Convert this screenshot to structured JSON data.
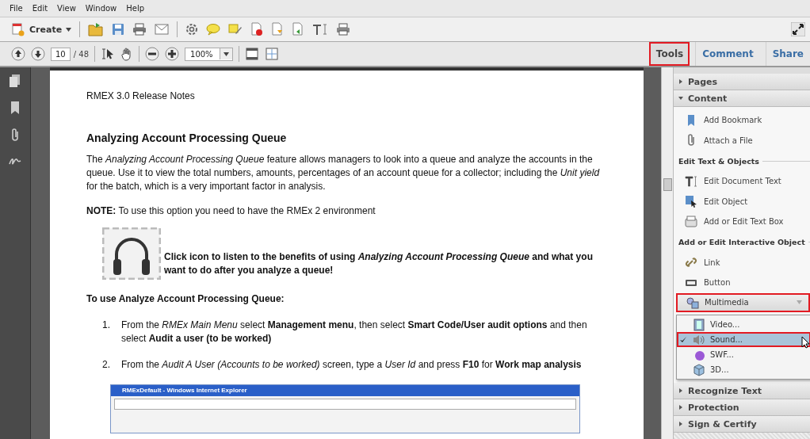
{
  "menu": [
    "File",
    "Edit",
    "View",
    "Window",
    "Help"
  ],
  "toolbar": {
    "create": "Create"
  },
  "nav": {
    "page": "10",
    "page_count": "/ 48",
    "zoom": "100%"
  },
  "panel_tabs": [
    {
      "label": "Tools",
      "selected": true,
      "highlighted": true
    },
    {
      "label": "Comment",
      "selected": false,
      "highlighted": false
    },
    {
      "label": "Share",
      "selected": false,
      "highlighted": false
    }
  ],
  "panel_sections_top": [
    {
      "label": "Pages",
      "expanded": false
    },
    {
      "label": "Content",
      "expanded": true
    }
  ],
  "content_entries": [
    {
      "kind": "item",
      "label": "Add Bookmark"
    },
    {
      "kind": "item",
      "label": "Attach a File"
    },
    {
      "kind": "heading",
      "label": "Edit Text & Objects"
    },
    {
      "kind": "item",
      "label": "Edit Document Text"
    },
    {
      "kind": "item",
      "label": "Edit Object"
    },
    {
      "kind": "item",
      "label": "Add or Edit Text Box"
    },
    {
      "kind": "heading",
      "label": "Add or Edit Interactive Object"
    },
    {
      "kind": "item",
      "label": "Link"
    },
    {
      "kind": "item",
      "label": "Button"
    },
    {
      "kind": "dropdown",
      "label": "Multimedia",
      "highlighted": true
    }
  ],
  "multimedia_menu": [
    {
      "label": "Video...",
      "checked": false,
      "selected": false
    },
    {
      "label": "Sound...",
      "checked": true,
      "selected": true
    },
    {
      "label": "SWF...",
      "checked": false,
      "selected": false
    },
    {
      "label": "3D...",
      "checked": false,
      "selected": false
    }
  ],
  "panel_sections_bottom": [
    {
      "label": "Recognize Text",
      "expanded": false
    },
    {
      "label": "Protection",
      "expanded": false
    },
    {
      "label": "Sign & Certify",
      "expanded": false
    }
  ],
  "document": {
    "header": "RMEX 3.0 Release Notes",
    "heading": "Analyzing Account Processing Queue",
    "intro": "The *Analyzing Account Processing Queue* feature allows managers to look into a queue and analyze the accounts in the queue.  Use it to view the total numbers, amounts, percentages of an account queue for a collector; including the *Unit yield* for the batch, which is a very important factor in analysis.",
    "note": "**NOTE:** To use this option you need to have the RMEx 2 environment",
    "audio_text": "Click icon to listen to the benefits of using *Analyzing Account Processing Queue* and what you want to do after you analyze a queue!",
    "steps_heading": "To use Analyze Account Processing Queue:",
    "steps": [
      {
        "number": "1.",
        "text": "From the *RMEx Main Menu* select **Management menu**, then select **Smart Code/User audit options** and then select **Audit a user (to be worked)**"
      },
      {
        "number": "2.",
        "text": "From the *Audit A User (Accounts to be worked)* screen, type a *User Id* and press **F10** for **Work map analysis**"
      }
    ],
    "screenshot_title": "RMExDefault - Windows Internet Explorer"
  }
}
